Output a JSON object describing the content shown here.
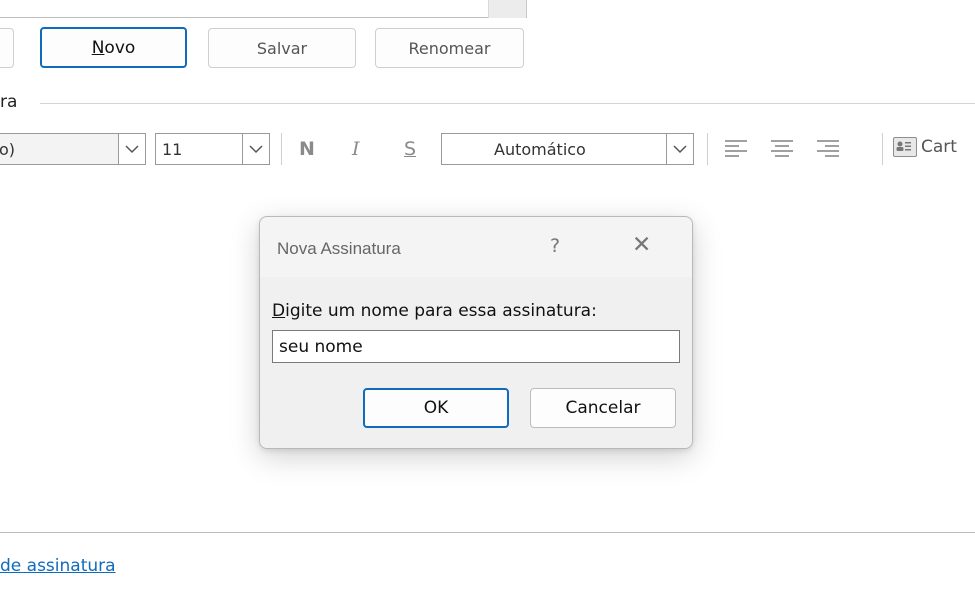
{
  "toolbar": {
    "novo_label": "Novo",
    "salvar_label": "Salvar",
    "renomear_label": "Renomear"
  },
  "editor": {
    "section_label": "ra",
    "font_value": "o)",
    "size_value": "11",
    "bold_label": "N",
    "italic_label": "I",
    "underline_label": "S",
    "color_value": "Automático",
    "card_label": "Cart"
  },
  "dialog": {
    "title": "Nova Assinatura",
    "help_glyph": "?",
    "close_glyph": "✕",
    "prompt_rest": "igite um nome para essa assinatura:",
    "prompt_mnemonic": "D",
    "input_value": "seu nome",
    "ok_label": "OK",
    "cancel_label": "Cancelar"
  },
  "footer": {
    "link_text": "de assinatura"
  },
  "colors": {
    "accent": "#0f6cbd",
    "dialog_bg": "#f0f0f0"
  }
}
